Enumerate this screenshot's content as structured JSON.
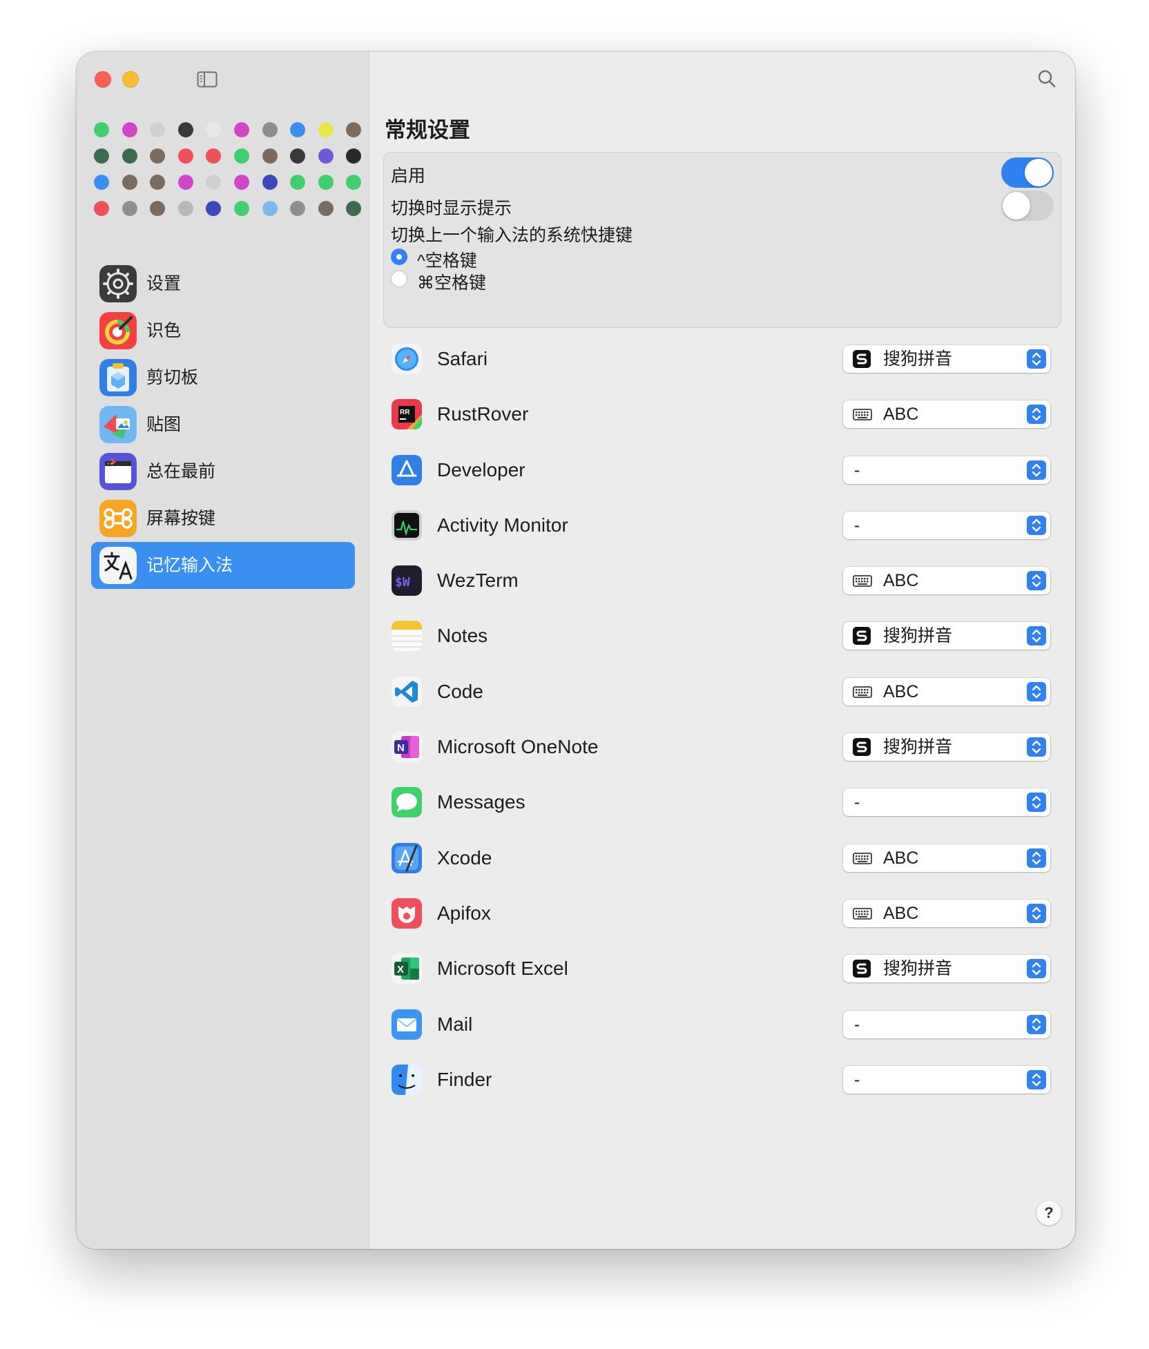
{
  "colors": {
    "accent": "#3b8ff0",
    "close": "#fe5f57",
    "minimize": "#febc2e"
  },
  "palette": [
    [
      "#3ecf6e",
      "#d245c8",
      "#cfcfcf",
      "#3a3a3a",
      "#e8e8e8",
      "#d245c8",
      "#8e8e8e",
      "#3a8ef0",
      "#e6e64a",
      "#7a6b5e"
    ],
    [
      "#3d6b4f",
      "#3d6b4f",
      "#7a6b5e",
      "#f0505a",
      "#f0505a",
      "#3ecf6e",
      "#7a6b5e",
      "#3a3a3a",
      "#6b5bd8",
      "#2a2a2a"
    ],
    [
      "#3a8ef0",
      "#7a6b5e",
      "#7a6b5e",
      "#d245c8",
      "#cfcfcf",
      "#d245c8",
      "#3b48b8",
      "#3ecf6e",
      "#3ecf6e",
      "#3ecf6e"
    ],
    [
      "#f0505a",
      "#8e8e8e",
      "#7a6b5e",
      "#b8b8b8",
      "#3b48b8",
      "#3ecf6e",
      "#7ab8f0",
      "#8e8e8e",
      "#7a6b5e",
      "#3d6b4f"
    ]
  ],
  "sidebar": {
    "items": [
      {
        "label": "设置",
        "icon": "gear-icon"
      },
      {
        "label": "识色",
        "icon": "color-picker-icon"
      },
      {
        "label": "剪切板",
        "icon": "clipboard-icon"
      },
      {
        "label": "贴图",
        "icon": "sticker-icon"
      },
      {
        "label": "总在最前",
        "icon": "window-pin-icon"
      },
      {
        "label": "屏幕按键",
        "icon": "command-key-icon"
      },
      {
        "label": "记忆输入法",
        "icon": "translate-icon"
      }
    ]
  },
  "general": {
    "title": "常规设置",
    "enable_label": "启用",
    "enable_on": true,
    "hint_label": "切换时显示提示",
    "hint_on": false,
    "shortcut_label": "切换上一个输入法的系统快捷键",
    "options": [
      {
        "label": "^空格键",
        "selected": true
      },
      {
        "label": "⌘空格键",
        "selected": false
      }
    ]
  },
  "apps": [
    {
      "name": "Safari",
      "icon": "safari-icon",
      "im": "搜狗拼音",
      "im_icon": "sogou-icon"
    },
    {
      "name": "RustRover",
      "icon": "rustrover-icon",
      "im": "ABC",
      "im_icon": "keyboard-icon"
    },
    {
      "name": "Developer",
      "icon": "developer-icon",
      "im": "-",
      "im_icon": ""
    },
    {
      "name": "Activity Monitor",
      "icon": "activity-monitor-icon",
      "im": "-",
      "im_icon": ""
    },
    {
      "name": "WezTerm",
      "icon": "wezterm-icon",
      "im": "ABC",
      "im_icon": "keyboard-icon"
    },
    {
      "name": "Notes",
      "icon": "notes-icon",
      "im": "搜狗拼音",
      "im_icon": "sogou-icon"
    },
    {
      "name": "Code",
      "icon": "vscode-icon",
      "im": "ABC",
      "im_icon": "keyboard-icon"
    },
    {
      "name": "Microsoft OneNote",
      "icon": "onenote-icon",
      "im": "搜狗拼音",
      "im_icon": "sogou-icon"
    },
    {
      "name": "Messages",
      "icon": "messages-icon",
      "im": "-",
      "im_icon": ""
    },
    {
      "name": "Xcode",
      "icon": "xcode-icon",
      "im": "ABC",
      "im_icon": "keyboard-icon"
    },
    {
      "name": "Apifox",
      "icon": "apifox-icon",
      "im": "ABC",
      "im_icon": "keyboard-icon"
    },
    {
      "name": "Microsoft Excel",
      "icon": "excel-icon",
      "im": "搜狗拼音",
      "im_icon": "sogou-icon"
    },
    {
      "name": "Mail",
      "icon": "mail-icon",
      "im": "-",
      "im_icon": ""
    },
    {
      "name": "Finder",
      "icon": "finder-icon",
      "im": "-",
      "im_icon": ""
    }
  ],
  "help_label": "?"
}
